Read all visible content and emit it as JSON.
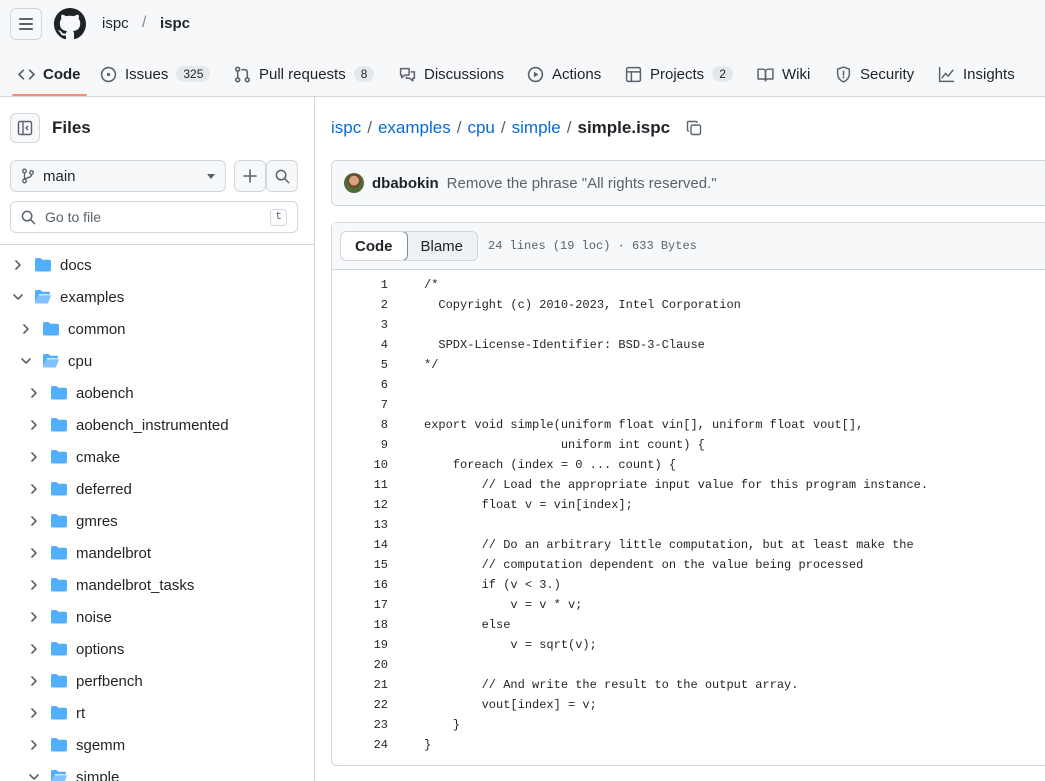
{
  "header": {
    "owner": "ispc",
    "separator": "/",
    "repo": "ispc"
  },
  "tabs": [
    {
      "label": "Code",
      "icon": "code-icon"
    },
    {
      "label": "Issues",
      "count": "325",
      "icon": "issue-icon"
    },
    {
      "label": "Pull requests",
      "count": "8",
      "icon": "pull-request-icon"
    },
    {
      "label": "Discussions",
      "icon": "discussions-icon"
    },
    {
      "label": "Actions",
      "icon": "play-icon"
    },
    {
      "label": "Projects",
      "count": "2",
      "icon": "table-icon"
    },
    {
      "label": "Wiki",
      "icon": "book-icon"
    },
    {
      "label": "Security",
      "icon": "shield-icon"
    },
    {
      "label": "Insights",
      "icon": "graph-icon"
    }
  ],
  "sidebar": {
    "title": "Files",
    "branch": "main",
    "goto_placeholder": "Go to file",
    "goto_shortcut": "t",
    "tree": [
      {
        "name": "docs",
        "expanded": false,
        "depth": 0
      },
      {
        "name": "examples",
        "expanded": true,
        "depth": 0
      },
      {
        "name": "common",
        "expanded": false,
        "depth": 1
      },
      {
        "name": "cpu",
        "expanded": true,
        "depth": 1
      },
      {
        "name": "aobench",
        "expanded": false,
        "depth": 2
      },
      {
        "name": "aobench_instrumented",
        "expanded": false,
        "depth": 2
      },
      {
        "name": "cmake",
        "expanded": false,
        "depth": 2
      },
      {
        "name": "deferred",
        "expanded": false,
        "depth": 2
      },
      {
        "name": "gmres",
        "expanded": false,
        "depth": 2
      },
      {
        "name": "mandelbrot",
        "expanded": false,
        "depth": 2
      },
      {
        "name": "mandelbrot_tasks",
        "expanded": false,
        "depth": 2
      },
      {
        "name": "noise",
        "expanded": false,
        "depth": 2
      },
      {
        "name": "options",
        "expanded": false,
        "depth": 2
      },
      {
        "name": "perfbench",
        "expanded": false,
        "depth": 2
      },
      {
        "name": "rt",
        "expanded": false,
        "depth": 2
      },
      {
        "name": "sgemm",
        "expanded": false,
        "depth": 2
      },
      {
        "name": "simple",
        "expanded": true,
        "depth": 2
      }
    ]
  },
  "breadcrumb": {
    "parts": [
      "ispc",
      "examples",
      "cpu",
      "simple"
    ],
    "separator": "/",
    "current": "simple.ispc"
  },
  "commit": {
    "author": "dbabokin",
    "message": "Remove the phrase \"All rights reserved.\""
  },
  "code": {
    "tab_code": "Code",
    "tab_blame": "Blame",
    "info": "24 lines (19 loc) · 633 Bytes",
    "lines": [
      "/*",
      "  Copyright (c) 2010-2023, Intel Corporation",
      "",
      "  SPDX-License-Identifier: BSD-3-Clause",
      "*/",
      "",
      "",
      "export void simple(uniform float vin[], uniform float vout[],",
      "                   uniform int count) {",
      "    foreach (index = 0 ... count) {",
      "        // Load the appropriate input value for this program instance.",
      "        float v = vin[index];",
      "",
      "        // Do an arbitrary little computation, but at least make the",
      "        // computation dependent on the value being processed",
      "        if (v < 3.)",
      "            v = v * v;",
      "        else",
      "            v = sqrt(v);",
      "",
      "        // And write the result to the output array.",
      "        vout[index] = v;",
      "    }",
      "}"
    ]
  },
  "colors": {
    "accent": "#0969da",
    "folder": "#54aeff",
    "tab_underline": "#fd8c73"
  }
}
